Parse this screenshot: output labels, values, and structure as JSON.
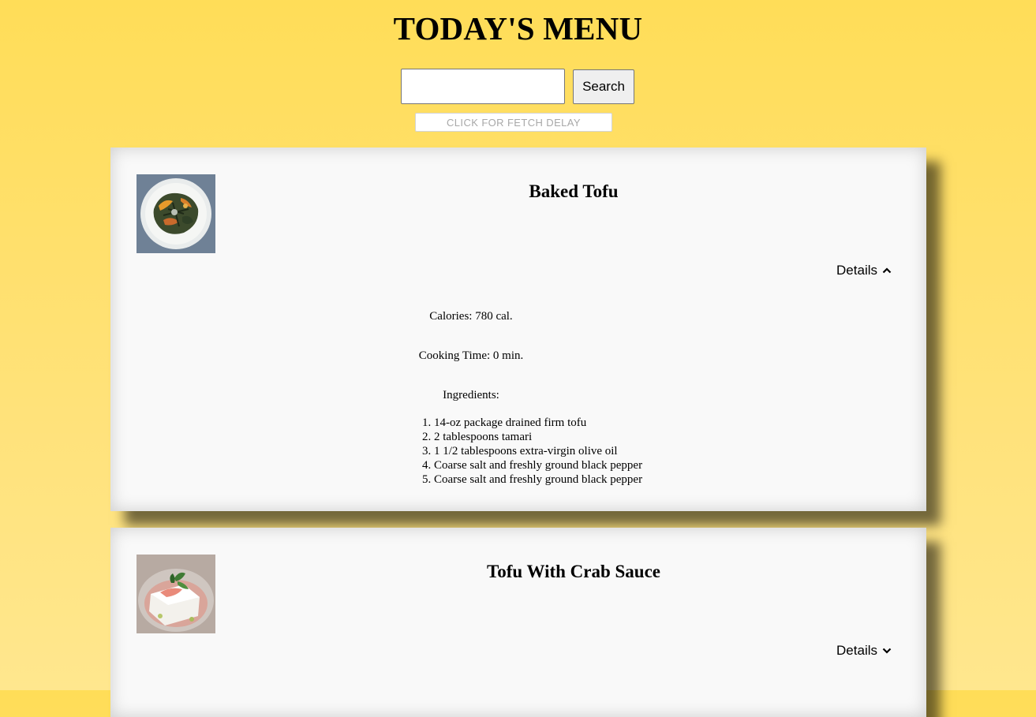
{
  "page": {
    "title": "TODAY'S MENU"
  },
  "search": {
    "value": "",
    "placeholder": "",
    "button_label": "Search",
    "fetch_delay_label": "CLICK FOR FETCH DELAY"
  },
  "recipes": [
    {
      "name": "Baked Tofu",
      "details_label": "Details",
      "expanded": true,
      "toggle_icon": "chevron-up-icon",
      "calories": "Calories: 780 cal.",
      "cooking_time": "Cooking Time: 0 min.",
      "ingredients_heading": "Ingredients:",
      "ingredients": [
        "1. 14-oz package drained firm tofu",
        "2. 2 tablespoons tamari",
        "3. 1 1/2 tablespoons extra-virgin olive oil",
        "4. Coarse salt and freshly ground black pepper",
        "5. Coarse salt and freshly ground black pepper"
      ]
    },
    {
      "name": "Tofu With Crab Sauce",
      "details_label": "Details",
      "expanded": false,
      "toggle_icon": "chevron-down-icon"
    }
  ],
  "colors": {
    "background": "#ffdd58",
    "card": "#f9f9f9"
  }
}
